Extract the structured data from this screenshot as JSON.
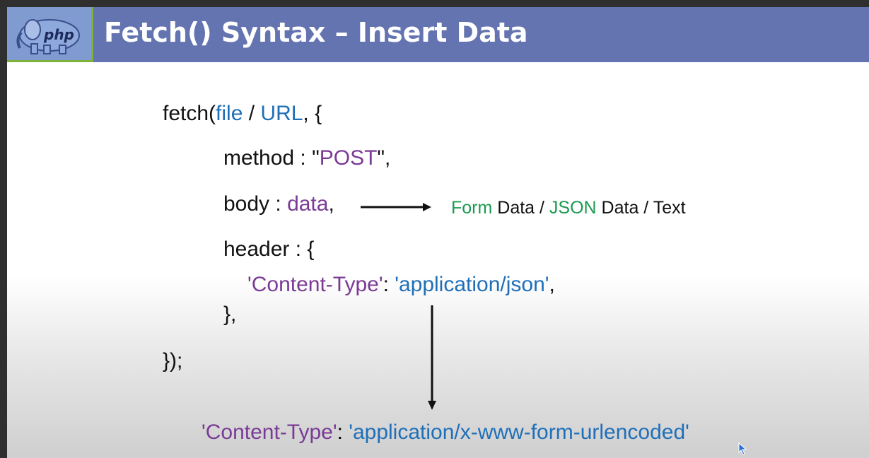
{
  "title": "Fetch() Syntax – Insert Data",
  "logo": {
    "text": "php",
    "icon": "php-elephant-logo"
  },
  "code": {
    "line1": {
      "fn": "fetch(",
      "arg1": "file",
      "sep": " / ",
      "arg2": "URL",
      "tail": ", {"
    },
    "method": {
      "key": "method : \"",
      "value": "POST",
      "tail": "\","
    },
    "body": {
      "key": "body : ",
      "value": "data",
      "tail": ","
    },
    "header_open": "header : {",
    "content_type": {
      "key": "'Content-Type'",
      "colon": ": ",
      "value": "'application/json'",
      "tail": ","
    },
    "header_close": "},",
    "closing": "});"
  },
  "body_note": {
    "form": "Form",
    "data1": " Data / ",
    "json": "JSON",
    "data2": " Data / Text"
  },
  "alt_content_type": {
    "key": "'Content-Type'",
    "colon": ": ",
    "value": "'application/x-www-form-urlencoded'"
  },
  "colors": {
    "title_bar": "#6474b0",
    "keyword_blue": "#1f6fb8",
    "value_purple": "#7a3a96",
    "note_green": "#1a9a50"
  }
}
